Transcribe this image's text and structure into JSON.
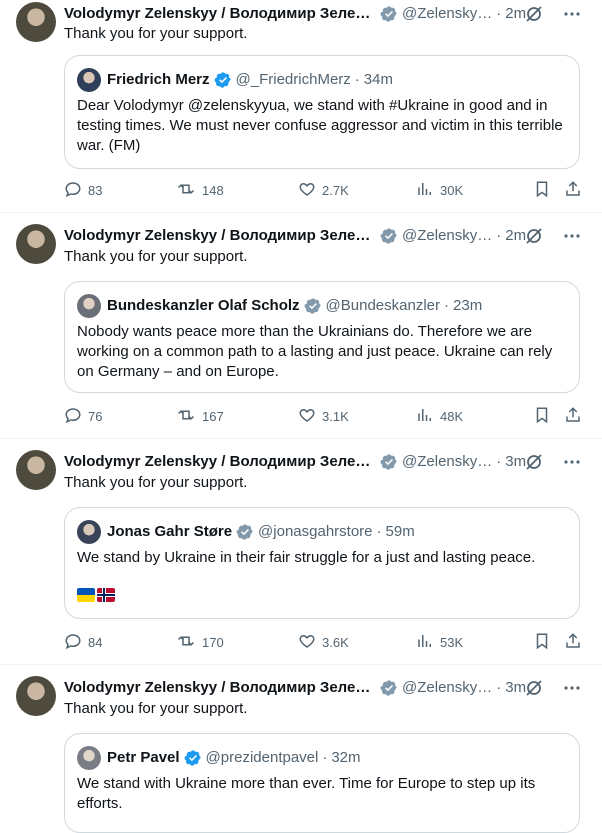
{
  "tweets": [
    {
      "author": "Volodymyr Zelenskyy / Володимир Зелен…",
      "handle": "@Zelensky…",
      "time": "2m",
      "text": "Thank you for your support.",
      "quote": {
        "author": "Friedrich Merz",
        "handle": "@_FriedrichMerz",
        "time": "34m",
        "text": "Dear Volodymyr @zelenskyyua, we stand with #Ukraine in good and in testing times. We must never confuse aggressor and victim in this terrible war. (FM)",
        "flags": []
      },
      "replies": "83",
      "reposts": "148",
      "likes": "2.7K",
      "views": "30K"
    },
    {
      "author": "Volodymyr Zelenskyy / Володимир Зелен…",
      "handle": "@Zelensky…",
      "time": "2m",
      "text": "Thank you for your support.",
      "quote": {
        "author": "Bundeskanzler Olaf Scholz",
        "handle": "@Bundeskanzler",
        "time": "23m",
        "text": "Nobody wants peace more than the Ukrainians do. Therefore we are working on a common path to a lasting and just peace. Ukraine can rely on Germany – and on Europe.",
        "flags": []
      },
      "replies": "76",
      "reposts": "167",
      "likes": "3.1K",
      "views": "48K"
    },
    {
      "author": "Volodymyr Zelenskyy / Володимир Зелен…",
      "handle": "@Zelensky…",
      "time": "3m",
      "text": "Thank you for your support.",
      "quote": {
        "author": "Jonas Gahr Støre",
        "handle": "@jonasgahrstore",
        "time": "59m",
        "text": "We stand by Ukraine in their fair struggle for a just and lasting peace.",
        "flags": [
          "ukraine-flag",
          "norway-flag"
        ]
      },
      "replies": "84",
      "reposts": "170",
      "likes": "3.6K",
      "views": "53K"
    },
    {
      "author": "Volodymyr Zelenskyy / Володимир Зелен…",
      "handle": "@Zelensky…",
      "time": "3m",
      "text": "Thank you for your support.",
      "quote": {
        "author": "Petr Pavel",
        "handle": "@prezidentpavel",
        "time": "32m",
        "text": "We stand with Ukraine more than ever. Time for Europe to step up its efforts.",
        "flags": []
      }
    }
  ],
  "separator": "·",
  "colors": {
    "verified": "#829aab",
    "muted": "#536471",
    "border": "#cfd9de"
  }
}
